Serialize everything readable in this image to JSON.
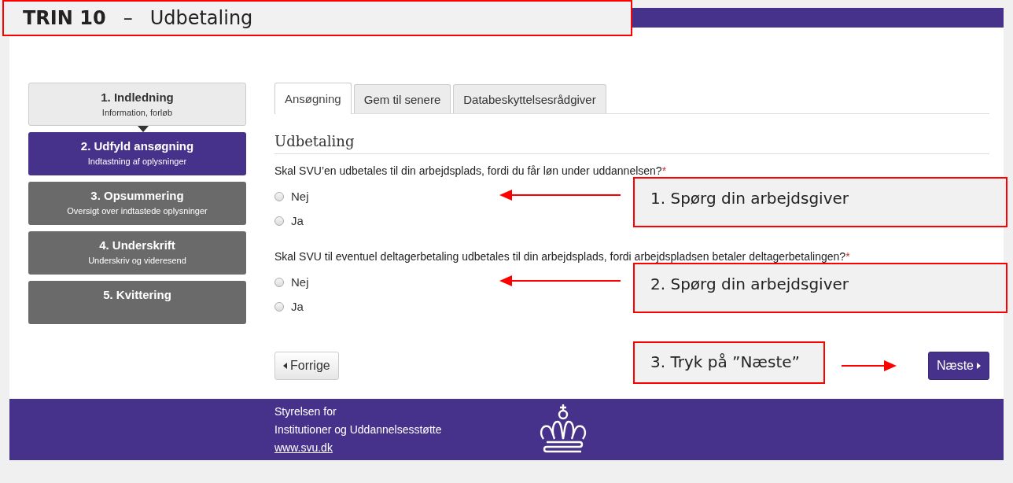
{
  "title_callout": {
    "step": "TRIN 10",
    "separator": "–",
    "title": "Udbetaling"
  },
  "steps": [
    {
      "title": "1. Indledning",
      "subtitle": "Information, forløb",
      "completed": true,
      "selected": false
    },
    {
      "title": "2. Udfyld ansøgning",
      "subtitle": "Indtastning af oplysninger",
      "completed": false,
      "selected": true
    },
    {
      "title": "3. Opsummering",
      "subtitle": "Oversigt over indtastede oplysninger",
      "completed": false,
      "selected": false
    },
    {
      "title": "4. Underskrift",
      "subtitle": "Underskriv og videresend",
      "completed": false,
      "selected": false
    },
    {
      "title": "5. Kvittering",
      "completed": false,
      "selected": false
    }
  ],
  "tabs": [
    {
      "label": "Ansøgning",
      "selected": true
    },
    {
      "label": "Gem til senere",
      "selected": false
    },
    {
      "label": "Databeskyttelsesrådgiver",
      "selected": false
    }
  ],
  "section_title": "Udbetaling",
  "questions": [
    {
      "text": "Skal SVU’en udbetales til din arbejdsplads, fordi du får løn under uddannelsen?",
      "required": "*",
      "options": [
        {
          "label": "Nej",
          "selected": false
        },
        {
          "label": "Ja",
          "selected": false
        }
      ],
      "callout": "1. Spørg din arbejdsgiver"
    },
    {
      "text": "Skal SVU til eventuel deltagerbetaling udbetales til din arbejdsplads, fordi arbejdspladsen betaler deltagerbetalingen?",
      "required": "*",
      "options": [
        {
          "label": "Nej",
          "selected": false
        },
        {
          "label": "Ja",
          "selected": false
        }
      ],
      "callout": "2. Spørg din arbejdsgiver"
    }
  ],
  "prev_button": "Forrige",
  "next_button": "Næste",
  "next_callout": "3. Tryk på ”Næste”",
  "footer": {
    "lines": [
      "Styrelsen for",
      "Institutioner og Uddannelsesstøtte"
    ],
    "link": "www.svu.dk"
  }
}
